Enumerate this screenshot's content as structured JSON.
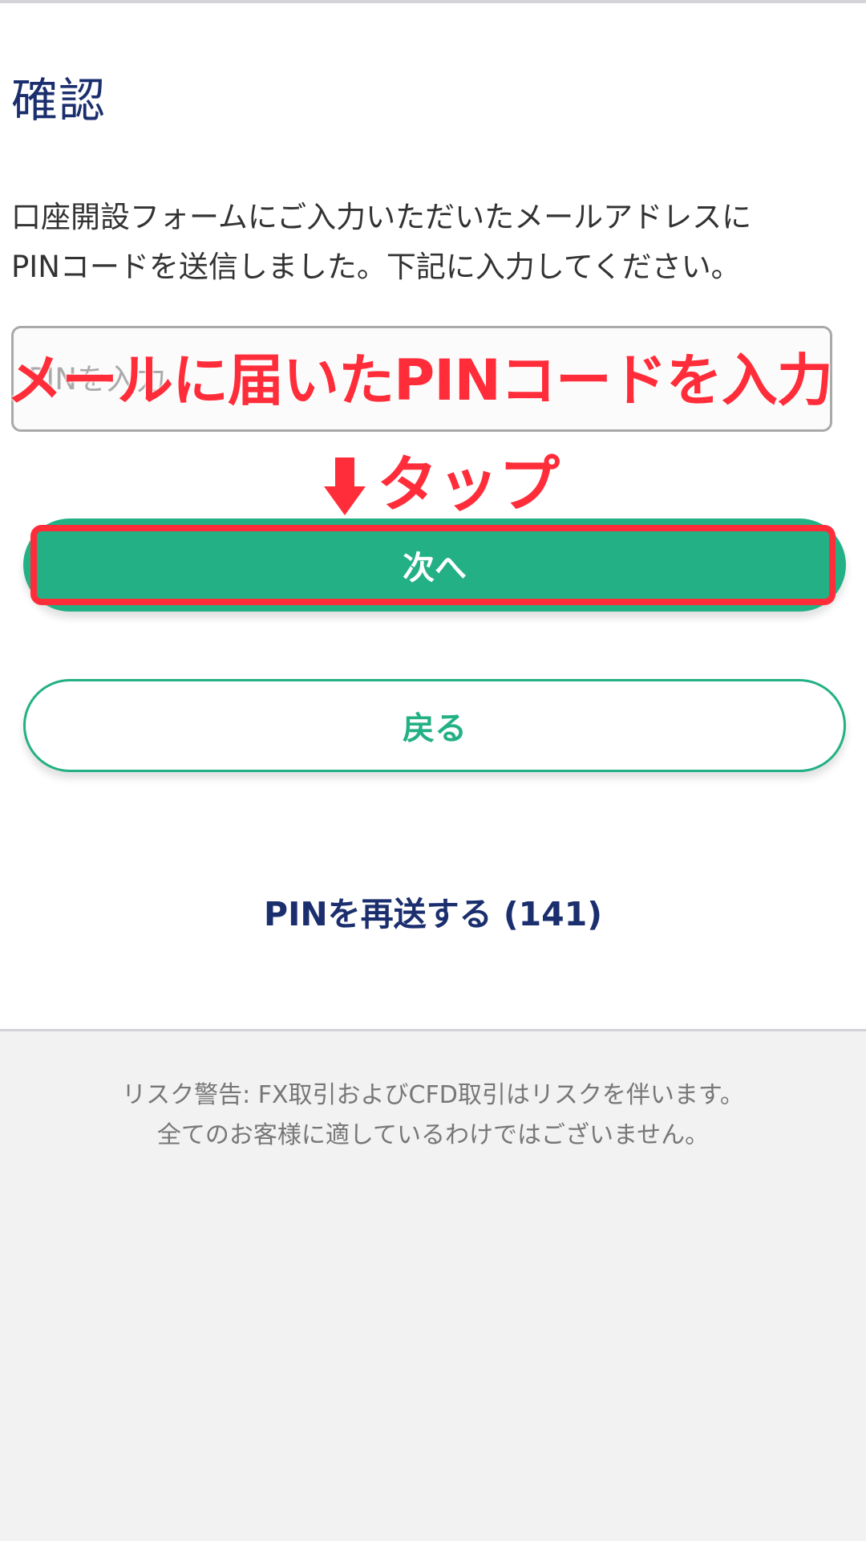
{
  "page": {
    "title": "確認"
  },
  "instruction": {
    "line1": "口座開設フォームにご入力いただいたメールアドレスに",
    "line2": "PINコードを送信しました。下記に入力してください。"
  },
  "pin_field": {
    "placeholder": "PINを入力",
    "value": ""
  },
  "annotations": {
    "enter_pin": "メールに届いたPINコードを入力",
    "tap": "タップ",
    "arrow_icon": "down-arrow-icon",
    "color": "#ff2d3a"
  },
  "buttons": {
    "next_label": "次へ",
    "back_label": "戻る"
  },
  "resend": {
    "label": "PINを再送する (141)"
  },
  "footer": {
    "line1": "リスク警告: FX取引およびCFD取引はリスクを伴います。",
    "line2": "全てのお客様に適しているわけではございません。"
  },
  "colors": {
    "accent": "#24b085",
    "title": "#1b2f6e",
    "annotation": "#ff2d3a"
  }
}
